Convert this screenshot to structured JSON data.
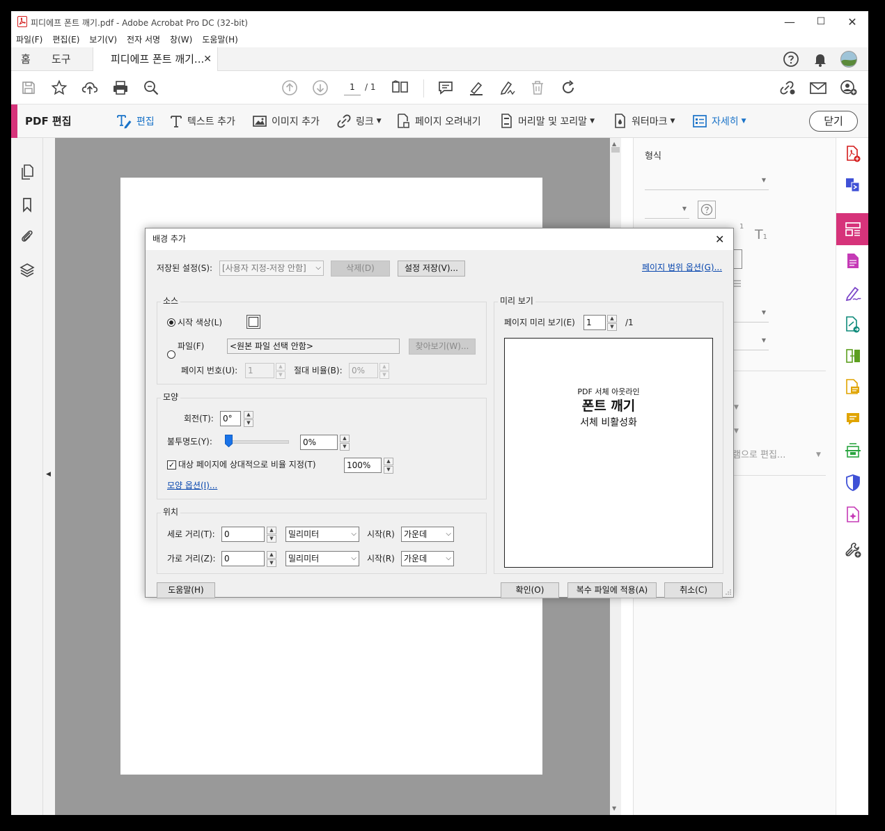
{
  "window": {
    "title": "피디에프 폰트 깨기.pdf - Adobe Acrobat Pro DC (32-bit)",
    "minimize": "—",
    "maximize": "☐",
    "close": "✕"
  },
  "menu": [
    "파일(F)",
    "편집(E)",
    "보기(V)",
    "전자 서명",
    "창(W)",
    "도움말(H)"
  ],
  "tabs": {
    "home": "홈",
    "tools": "도구",
    "document": "피디에프 폰트 깨기...",
    "close": "✕"
  },
  "toolbar": {
    "page_current": "1",
    "page_total": "/ 1"
  },
  "edit_toolbar": {
    "title": "PDF 편집",
    "edit": "편집",
    "add_text": "텍스트 추가",
    "add_image": "이미지 추가",
    "link": "링크",
    "crop": "페이지 오려내기",
    "header_footer": "머리말 및 꼬리말",
    "watermark": "워터마크",
    "more": "자세히",
    "close": "닫기",
    "accent_color": "#d6337a",
    "active_color": "#1a73c8"
  },
  "right_panel": {
    "format_label": "형식",
    "partial_text": "램으로 편집..."
  },
  "dialog": {
    "title": "배경 추가",
    "close": "✕",
    "saved_settings_label": "저장된 설정(S):",
    "saved_settings_value": "[사용자 지정-저장 안함]",
    "delete_button": "삭제(D)",
    "save_settings_button": "설정 저장(V)...",
    "page_range_link": "페이지 범위 옵션(G)...",
    "source": {
      "group": "소스",
      "color_label": "시작 색상(L)",
      "file_label": "파일(F)",
      "file_value": "<원본 파일 선택 안함>",
      "browse_button": "찾아보기(W)...",
      "page_number_label": "페이지 번호(U):",
      "page_number_value": "1",
      "absolute_scale_label": "절대 비율(B):",
      "absolute_scale_value": "0%"
    },
    "appearance": {
      "group": "모양",
      "rotation_label": "회전(T):",
      "rotation_value": "0°",
      "opacity_label": "불투명도(Y):",
      "opacity_value": "0%",
      "opacity_level": 0,
      "relative_scale_label": "대상 페이지에 상대적으로 비율 지정(T)",
      "relative_scale_checked": true,
      "relative_scale_value": "100%",
      "appearance_options_link": "모양 옵션(I)..."
    },
    "position": {
      "group": "위치",
      "vertical_label": "세로 거리(T):",
      "vertical_value": "0",
      "vertical_unit": "밀리미터",
      "vertical_from_label": "시작(R)",
      "vertical_from_value": "가운데",
      "horizontal_label": "가로 거리(Z):",
      "horizontal_value": "0",
      "horizontal_unit": "밀리미터",
      "horizontal_from_label": "시작(R)",
      "horizontal_from_value": "가운데"
    },
    "preview": {
      "group": "미리 보기",
      "page_label": "페이지 미리 보기(E)",
      "page_value": "1",
      "page_total": "/1",
      "line1": "PDF 서체 아웃라인",
      "line2": "폰트 깨기",
      "line3": "서체 비활성화"
    },
    "help_button": "도움말(H)",
    "ok_button": "확인(O)",
    "batch_button": "복수 파일에 적용(A)",
    "cancel_button": "취소(C)"
  }
}
